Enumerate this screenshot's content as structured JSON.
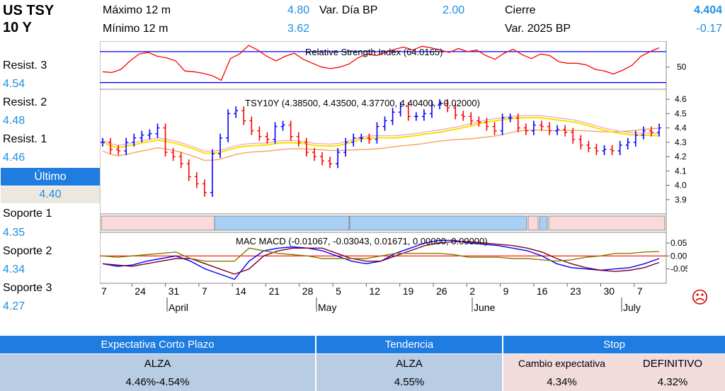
{
  "header": {
    "title_line1": "US TSY",
    "title_line2": "10 Y",
    "max_label": "Máximo 12 m",
    "max_value": "4.80",
    "min_label": "Mínimo 12 m",
    "min_value": "3.62",
    "var_dia_label": "Var. Día BP",
    "var_dia_value": "2.00",
    "cierre_label": "Cierre",
    "cierre_value": "4.404",
    "var_ytd_label": "Var. 2025 BP",
    "var_ytd_value": "-0.17"
  },
  "levels": {
    "resist3_label": "Resist. 3",
    "resist3_value": "4.54",
    "resist2_label": "Resist. 2",
    "resist2_value": "4.48",
    "resist1_label": "Resist. 1",
    "resist1_value": "4.46",
    "ultimo_label": "Último",
    "ultimo_value": "4.40",
    "soporte1_label": "Soporte 1",
    "soporte1_value": "4.35",
    "soporte2_label": "Soporte 2",
    "soporte2_value": "4.34",
    "soporte3_label": "Soporte 3",
    "soporte3_value": "4.27"
  },
  "bottom": {
    "expectativa_header": "Expectativa Corto Plazo",
    "expectativa_value": "ALZA",
    "expectativa_range": "4.46%-4.54%",
    "tendencia_header": "Tendencia",
    "tendencia_value": "ALZA",
    "tendencia_level": "4.55%",
    "stop_header": "Stop",
    "cambio_label": "Cambio expectativa",
    "cambio_value": "4.34%",
    "definitivo_label": "DEFINITIVO",
    "definitivo_value": "4.32%"
  },
  "colors": {
    "header_blue": "#1f7ce0",
    "value_blue": "#1f8fe0",
    "up_bar": "#0000ff",
    "down_bar": "#ff0000",
    "ma_yellow": "#f5e200",
    "ma_pink": "#f0b0c0",
    "ma_orange": "#f4a460",
    "band_blue": "#a8d0f5",
    "band_pink": "#f9d9d9",
    "expectativa_bg": "#b8cce4",
    "stop_bg": "#f2dcdb"
  },
  "sad_face_icon": "☹",
  "chart_data": [
    {
      "type": "line",
      "title": "Relative Strength Index (64.0165)",
      "series": [
        {
          "values": [
            44,
            43,
            47,
            58,
            67,
            69,
            64,
            62,
            58,
            45,
            44,
            42,
            39,
            33,
            61,
            67,
            78,
            72,
            64,
            58,
            64,
            68,
            60,
            55,
            50,
            48,
            50,
            54,
            62,
            67,
            65,
            69,
            73,
            76,
            72,
            77,
            75,
            72,
            69,
            74,
            70,
            72,
            65,
            60,
            68,
            73,
            66,
            61,
            67,
            65,
            57,
            55,
            55,
            53,
            47,
            45,
            41,
            46,
            52,
            64,
            70,
            75
          ]
        }
      ],
      "ytick_labels": [
        "50"
      ],
      "reference_lines": [
        30,
        70
      ],
      "ylim": [
        25,
        80
      ]
    },
    {
      "type": "line",
      "subtype": "ohlc",
      "title": "TSY10Y (4.38500, 4.43500, 4.37700, 4.40400, +0.02000)",
      "series": [
        {
          "name": "close",
          "values": [
            4.3,
            4.25,
            4.24,
            4.3,
            4.33,
            4.35,
            4.36,
            4.4,
            4.23,
            4.2,
            4.15,
            4.06,
            4.01,
            3.95,
            4.22,
            4.33,
            4.5,
            4.52,
            4.45,
            4.38,
            4.34,
            4.32,
            4.41,
            4.42,
            4.34,
            4.3,
            4.23,
            4.2,
            4.17,
            4.15,
            4.23,
            4.3,
            4.33,
            4.33,
            4.32,
            4.41,
            4.45,
            4.51,
            4.55,
            4.48,
            4.48,
            4.5,
            4.56,
            4.57,
            4.54,
            4.49,
            4.48,
            4.45,
            4.44,
            4.41,
            4.38,
            4.47,
            4.47,
            4.4,
            4.38,
            4.42,
            4.41,
            4.38,
            4.39,
            4.37,
            4.32,
            4.28,
            4.26,
            4.24,
            4.25,
            4.24,
            4.28,
            4.3,
            4.35,
            4.38,
            4.37,
            4.4
          ]
        }
      ],
      "ytick_labels": [
        "3.9",
        "4.0",
        "4.1",
        "4.2",
        "4.3",
        "4.4",
        "4.5",
        "4.6"
      ],
      "ylim": [
        3.82,
        4.65
      ]
    },
    {
      "type": "line",
      "title": "MAC MACD (-0.01067, -0.03043, 0.01671, 0.00000, 0.00000)",
      "series": [
        {
          "name": "MACD",
          "values": [
            -0.03,
            -0.04,
            -0.035,
            -0.02,
            -0.01,
            0.0,
            -0.02,
            -0.05,
            -0.07,
            -0.09,
            -0.02,
            0.02,
            0.03,
            0.035,
            0.03,
            0.02,
            0.0,
            -0.02,
            -0.03,
            -0.02,
            0.01,
            0.03,
            0.05,
            0.06,
            0.06,
            0.05,
            0.045,
            0.04,
            0.03,
            0.02,
            0.0,
            -0.03,
            -0.045,
            -0.05,
            -0.055,
            -0.05,
            -0.045,
            -0.03,
            -0.01
          ]
        },
        {
          "name": "Signal",
          "values": [
            -0.03,
            -0.035,
            -0.04,
            -0.03,
            -0.02,
            -0.01,
            -0.01,
            -0.03,
            -0.05,
            -0.07,
            -0.05,
            0.0,
            0.02,
            0.03,
            0.03,
            0.03,
            0.01,
            -0.01,
            -0.02,
            -0.02,
            0.0,
            0.02,
            0.04,
            0.05,
            0.055,
            0.055,
            0.05,
            0.045,
            0.04,
            0.03,
            0.015,
            -0.01,
            -0.03,
            -0.045,
            -0.055,
            -0.06,
            -0.055,
            -0.045,
            -0.025
          ]
        },
        {
          "name": "Histogram",
          "values": [
            0.0,
            -0.005,
            0.0,
            0.005,
            0.01,
            0.015,
            -0.01,
            -0.02,
            -0.02,
            -0.02,
            0.03,
            0.02,
            0.01,
            0.005,
            0.0,
            -0.01,
            -0.01,
            -0.01,
            -0.01,
            0.0,
            0.01,
            0.01,
            0.01,
            0.01,
            0.005,
            -0.005,
            -0.005,
            -0.005,
            -0.01,
            -0.01,
            -0.015,
            -0.02,
            -0.015,
            -0.005,
            0.0,
            0.01,
            0.01,
            0.015,
            0.017
          ]
        }
      ],
      "ytick_labels": [
        "0.05",
        "0.00",
        "-0.05"
      ],
      "ylim": [
        -0.1,
        0.08
      ]
    }
  ],
  "axis": {
    "x_tick_labels": [
      "7",
      "24",
      "31",
      "7",
      "14",
      "21",
      "28",
      "5",
      "12",
      "19",
      "26",
      "2",
      "9",
      "16",
      "23",
      "30",
      "7"
    ],
    "month_labels": [
      "April",
      "May",
      "June",
      "July"
    ]
  }
}
